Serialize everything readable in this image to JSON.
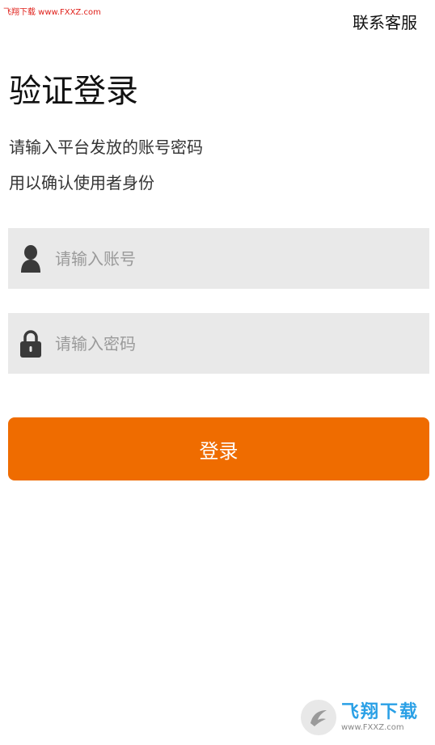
{
  "watermark": {
    "top_text": "飞翔下载 www.FXXZ.com",
    "logo_text": "飞翔下载",
    "logo_url": "www.FXXZ.com"
  },
  "header": {
    "contact_label": "联系客服"
  },
  "main": {
    "title": "验证登录",
    "subtitle_line1": "请输入平台发放的账号密码",
    "subtitle_line2": "用以确认使用者身份"
  },
  "form": {
    "account": {
      "placeholder": "请输入账号",
      "value": "",
      "icon": "user-icon"
    },
    "password": {
      "placeholder": "请输入密码",
      "value": "",
      "icon": "lock-icon"
    },
    "login_label": "登录"
  },
  "colors": {
    "accent": "#ef6c00",
    "field_bg": "#e9e9e9",
    "icon": "#3a3a3a"
  }
}
